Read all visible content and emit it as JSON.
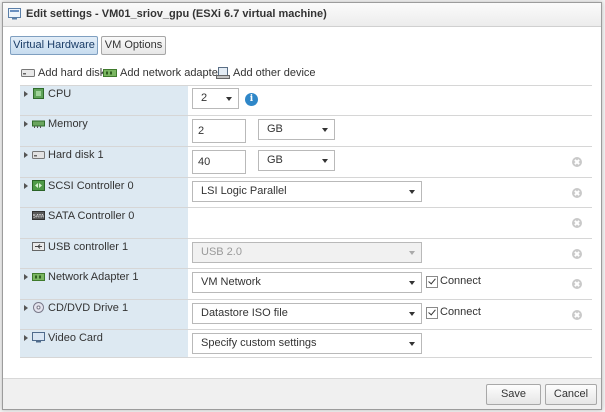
{
  "window": {
    "title": "Edit settings - VM01_sriov_gpu (ESXi 6.7 virtual machine)"
  },
  "tabs": [
    {
      "label": "Virtual Hardware",
      "active": true
    },
    {
      "label": "VM Options",
      "active": false
    }
  ],
  "toolbar": {
    "add_hard_disk": "Add hard disk",
    "add_network_adapter": "Add network adapter",
    "add_other_device": "Add other device"
  },
  "hardware": {
    "cpu": {
      "label": "CPU",
      "value": "2"
    },
    "memory": {
      "label": "Memory",
      "value": "2",
      "unit": "GB"
    },
    "hard_disk": {
      "label": "Hard disk 1",
      "value": "40",
      "unit": "GB"
    },
    "scsi": {
      "label": "SCSI Controller 0",
      "value": "LSI Logic Parallel"
    },
    "sata": {
      "label": "SATA Controller 0"
    },
    "usb": {
      "label": "USB controller 1",
      "value": "USB 2.0"
    },
    "network": {
      "label": "Network Adapter 1",
      "value": "VM Network",
      "connect_label": "Connect",
      "connected": true
    },
    "cdrom": {
      "label": "CD/DVD Drive 1",
      "value": "Datastore ISO file",
      "connect_label": "Connect",
      "connected": true
    },
    "video": {
      "label": "Video Card",
      "value": "Specify custom settings"
    }
  },
  "footer": {
    "save_label": "Save",
    "cancel_label": "Cancel"
  },
  "colors": {
    "label_cell_bg": "#dde9f2",
    "info_icon": "#2f87c8",
    "active_tab": "#c7dcef"
  }
}
